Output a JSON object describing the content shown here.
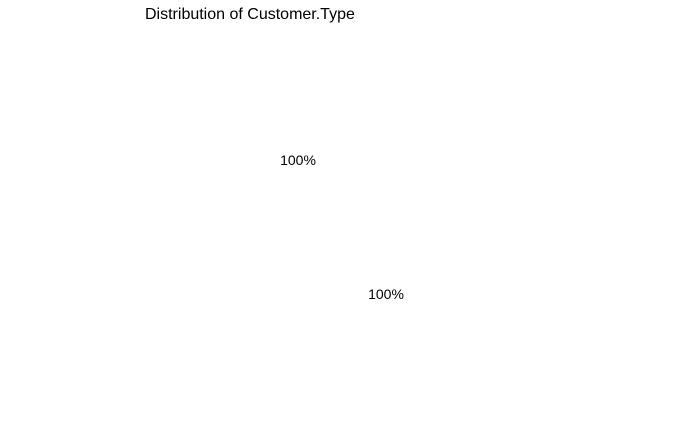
{
  "chart_data": {
    "type": "pie",
    "title": "Distribution of Customer.Type",
    "categories": [
      "",
      ""
    ],
    "values": [
      100,
      100
    ],
    "labels": [
      "100%",
      "100%"
    ],
    "colors": [
      "#ffffff",
      "#ffffff"
    ],
    "legend": "none"
  }
}
